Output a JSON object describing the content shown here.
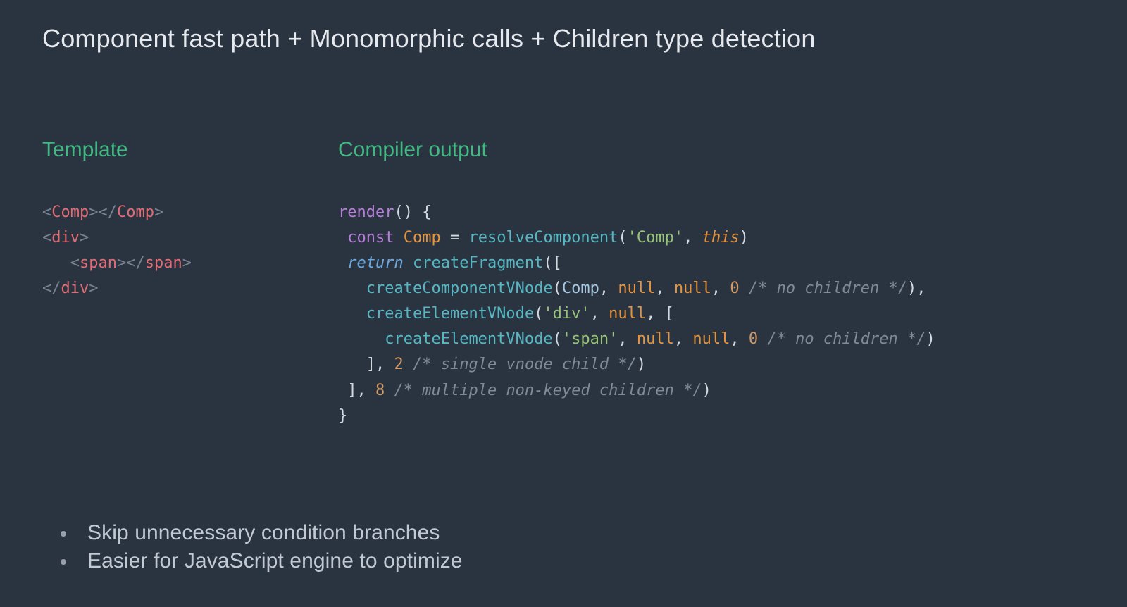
{
  "title": "Component fast path + Monomorphic calls + Children type detection",
  "sections": {
    "template_label": "Template",
    "compiler_label": "Compiler output"
  },
  "template_code": {
    "l1": {
      "open": "<",
      "tag": "Comp",
      "close1": ">",
      "open2": "</",
      "close2": ">"
    },
    "l2": {
      "open": "<",
      "tag": "div",
      "close": ">"
    },
    "l3": {
      "indent": "   ",
      "open": "<",
      "tag": "span",
      "close1": ">",
      "open2": "</",
      "close2": ">"
    },
    "l4": {
      "open": "</",
      "tag": "div",
      "close": ">"
    }
  },
  "compiler_code": {
    "render": "render",
    "parens_open": "() {",
    "const_kw": "const",
    "comp_id": "Comp",
    "eq": " = ",
    "resolve_fn": "resolveComponent",
    "str_comp": "'Comp'",
    "this_kw": "this",
    "return_kw": "return",
    "create_fragment": "createFragment",
    "create_comp": "createComponentVNode",
    "create_elem": "createElementVNode",
    "null_kw": "null",
    "str_div": "'div'",
    "str_span": "'span'",
    "n0": "0",
    "n2": "2",
    "n8": "8",
    "cm_no_children": "/* no children */",
    "cm_single": "/* single vnode child */",
    "cm_multi": "/* multiple non-keyed children */"
  },
  "bullets": [
    "Skip unnecessary condition branches",
    "Easier for JavaScript engine to optimize"
  ]
}
